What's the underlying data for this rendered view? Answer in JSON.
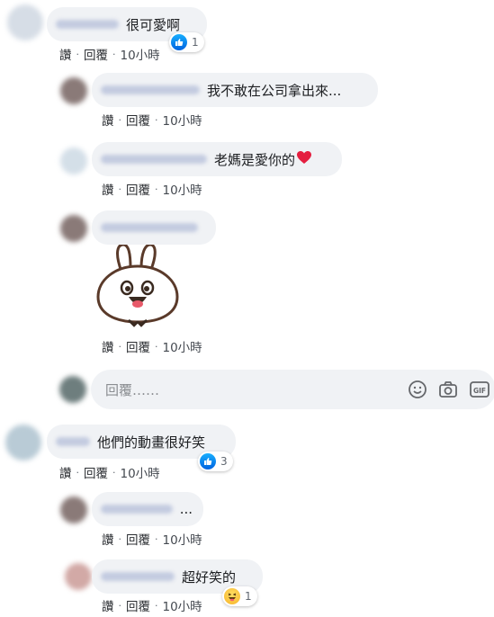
{
  "actions": {
    "like": "讚",
    "reply": "回覆",
    "separator": "·",
    "time": "10小時"
  },
  "comments": [
    {
      "text": "很可愛啊",
      "reaction_count": "1"
    },
    {
      "text": "我不敢在公司拿出來..."
    },
    {
      "text": "老媽是愛你的"
    },
    {
      "text": ""
    },
    {
      "text": "他們的動畫很好笑",
      "reaction_count": "3"
    },
    {
      "text": "..."
    },
    {
      "text": "超好笑的",
      "reaction_count": "1"
    }
  ],
  "reply_box": {
    "placeholder": "回覆……"
  },
  "icons": [
    "like-reaction-icon",
    "heart-emoji-icon",
    "haha-reaction-icon",
    "emoji-icon",
    "camera-icon",
    "gif-icon"
  ],
  "colors": {
    "bubble": "#f0f2f5",
    "like_blue": "#1877f2",
    "heart_red": "#e41e3f",
    "haha_yellow": "#f7b125"
  }
}
